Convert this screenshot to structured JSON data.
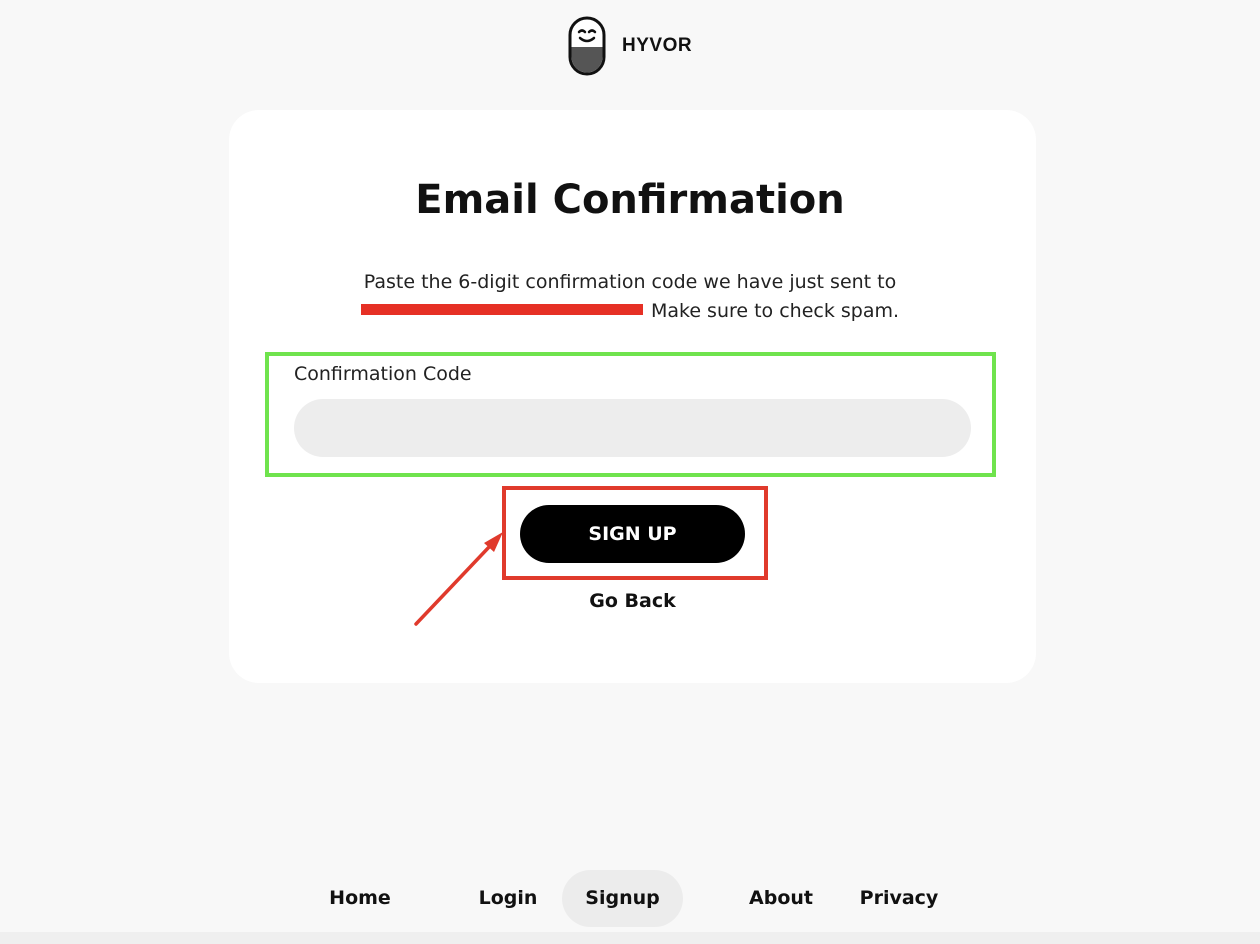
{
  "brand": {
    "name": "HYVOR",
    "logo_icon": "hyvor-face-logo-icon"
  },
  "card": {
    "title": "Email Confirmation",
    "subtitle_line1": "Paste the 6-digit confirmation code we have just sent to",
    "subtitle_line2": "Make sure to check spam.",
    "field_label": "Confirmation Code",
    "code_value": "",
    "signup_label": "SIGN UP",
    "go_back_label": "Go Back"
  },
  "annotations": {
    "field_highlight_color": "#6fe34d",
    "button_highlight_color": "#e03a2c",
    "arrow_color": "#e03a2c",
    "redaction_color": "#e63025"
  },
  "footer": {
    "items": [
      {
        "label": "Home",
        "active": false
      },
      {
        "label": "Login",
        "active": false
      },
      {
        "label": "Signup",
        "active": true
      },
      {
        "label": "About",
        "active": false
      },
      {
        "label": "Privacy",
        "active": false
      }
    ]
  }
}
